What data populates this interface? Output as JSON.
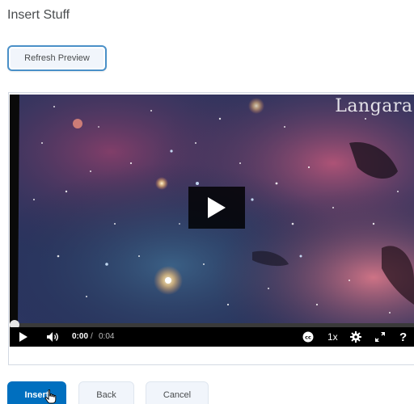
{
  "dialog": {
    "title": "Insert Stuff"
  },
  "toolbar": {
    "refresh_label": "Refresh Preview"
  },
  "player": {
    "watermark": "Langara.",
    "current_time": "0:00",
    "separator": "/",
    "duration": "0:04",
    "speed": "1x",
    "help": "?",
    "progress": 0,
    "icons": [
      "play-icon",
      "volume-icon",
      "captions-icon",
      "settings-gear-icon",
      "fullscreen-icon"
    ]
  },
  "footer": {
    "insert_label": "Insert",
    "back_label": "Back",
    "cancel_label": "Cancel"
  },
  "colors": {
    "primary": "#006fbf",
    "secondary_bg": "#f1f5fb",
    "focus_ring": "#4a90c8",
    "text": "#494c4e"
  }
}
